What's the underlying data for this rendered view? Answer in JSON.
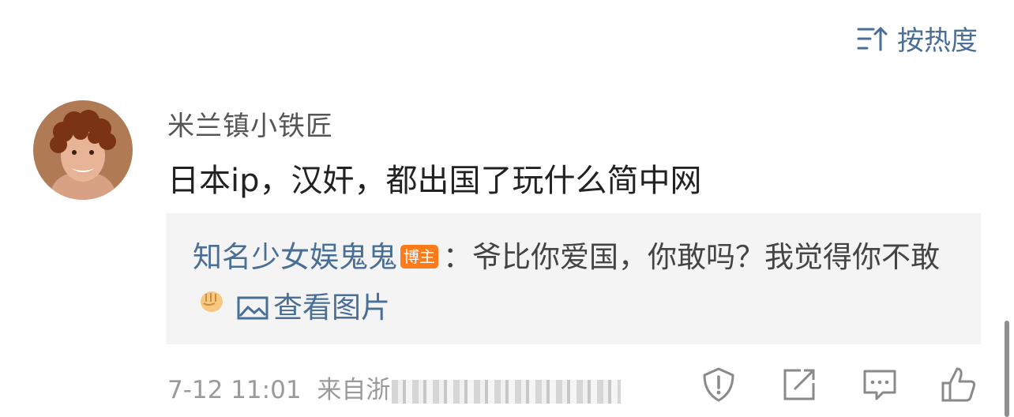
{
  "sort": {
    "label": "按热度",
    "icon": "sort-lines-up-arrow-icon"
  },
  "comment": {
    "avatar_icon": "avatar",
    "username": "米兰镇小铁匠",
    "text": "日本ip，汉奸，都出国了玩什么简中网"
  },
  "reply": {
    "username": "知名少女娱鬼鬼",
    "badge": "博主",
    "text": "：爷比你爱国，你敢吗？我觉得你不敢",
    "emoji": "fist-emoji",
    "view_image_label": "查看图片"
  },
  "meta": {
    "time": "7-12 11:01",
    "source": "来自浙"
  },
  "actions": [
    "report-icon",
    "share-icon",
    "comment-icon",
    "like-icon"
  ],
  "colors": {
    "link": "#4a6f97",
    "badge": "#ff7a1a",
    "reply_bg": "#f4f4f4",
    "meta": "#9a9a9a"
  }
}
